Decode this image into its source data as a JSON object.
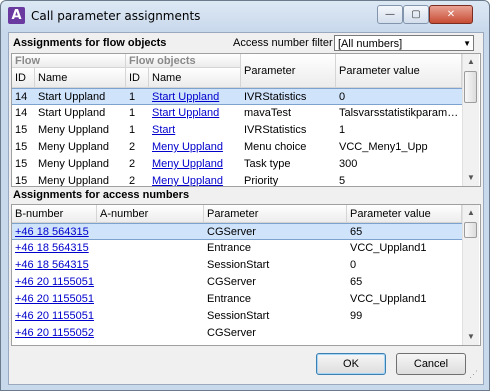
{
  "window": {
    "title": "Call parameter assignments",
    "app_icon_glyph": "A",
    "min": "—",
    "max": "▢",
    "close": "✕"
  },
  "flow_section": {
    "title": "Assignments for flow objects",
    "filter_label": "Access number filter",
    "filter_value": "[All numbers]",
    "group_flow": "Flow",
    "group_flow_objects": "Flow objects",
    "columns": [
      "ID",
      "Name",
      "ID",
      "Name",
      "Parameter",
      "Parameter value"
    ],
    "rows": [
      [
        "14",
        "Start Uppland",
        "1",
        "Start Uppland",
        "IVRStatistics",
        "0"
      ],
      [
        "14",
        "Start Uppland",
        "1",
        "Start Uppland",
        "mavaTest",
        "Talsvarsstatistikparam…"
      ],
      [
        "15",
        "Meny Uppland",
        "1",
        "Start",
        "IVRStatistics",
        "1"
      ],
      [
        "15",
        "Meny Uppland",
        "2",
        "Meny Uppland",
        "Menu choice",
        "VCC_Meny1_Upp"
      ],
      [
        "15",
        "Meny Uppland",
        "2",
        "Meny Uppland",
        "Task type",
        "300"
      ],
      [
        "15",
        "Meny Uppland",
        "2",
        "Meny Uppland",
        "Priority",
        "5"
      ],
      [
        "",
        "",
        "",
        "",
        "",
        ""
      ]
    ]
  },
  "access_section": {
    "title": "Assignments for access numbers",
    "columns": [
      "B-number",
      "A-number",
      "Parameter",
      "Parameter value"
    ],
    "rows": [
      [
        "+46 18 564315",
        "",
        "CGServer",
        "65"
      ],
      [
        "+46 18 564315",
        "",
        "Entrance",
        "VCC_Uppland1"
      ],
      [
        "+46 18 564315",
        "",
        "SessionStart",
        "0"
      ],
      [
        "+46 20 1155051",
        "",
        "CGServer",
        "65"
      ],
      [
        "+46 20 1155051",
        "",
        "Entrance",
        "VCC_Uppland1"
      ],
      [
        "+46 20 1155051",
        "",
        "SessionStart",
        "99"
      ],
      [
        "+46 20 1155052",
        "",
        "CGServer",
        ""
      ],
      [
        "",
        "",
        "",
        ""
      ]
    ]
  },
  "buttons": {
    "ok": "OK",
    "cancel": "Cancel"
  },
  "colors": {
    "selection": "#cfe3fb",
    "link": "#0000cc"
  }
}
